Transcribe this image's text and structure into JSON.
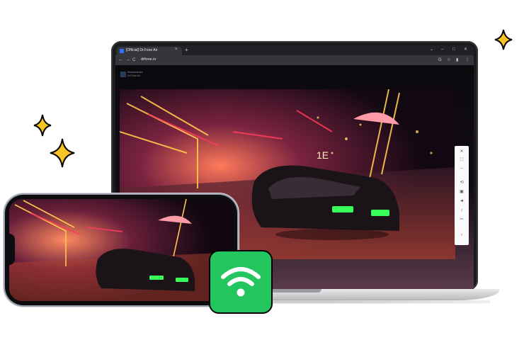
{
  "browser": {
    "tab_title": "[Official] Dr.Fone Air",
    "tab_close": "×",
    "new_tab": "+",
    "window_controls": [
      "⌄",
      "–",
      "□",
      "✕"
    ],
    "nav": [
      "←",
      "→",
      "C"
    ],
    "url": "drfone.io",
    "tools": [
      "G",
      "☆",
      "▮",
      "⋮"
    ]
  },
  "page": {
    "logo_text_line1": "Wondershare",
    "logo_text_line2": "Dr.Fone Air",
    "video_label": "1E"
  },
  "side_toolbar": {
    "icons": [
      "close-icon",
      "fullscreen-icon",
      "minimize-icon",
      "rotate-icon",
      "screenshot-icon",
      "volume-icon",
      "mic-icon",
      "pin-icon",
      "collapse-icon"
    ]
  },
  "colors": {
    "accent_green": "#22c55e",
    "sparkle": "#f7c325",
    "browser_dark": "#202124"
  }
}
